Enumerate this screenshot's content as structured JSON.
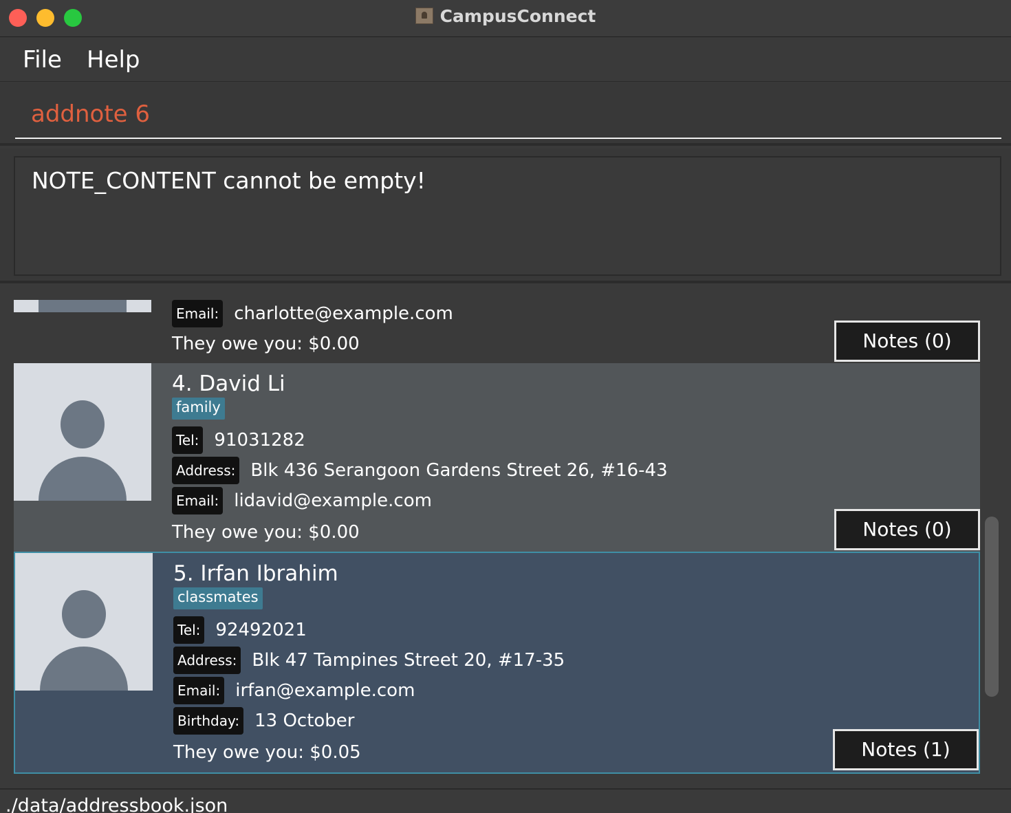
{
  "window": {
    "title": "CampusConnect",
    "icon": "contacts-app-icon"
  },
  "menu": {
    "items": [
      "File",
      "Help"
    ]
  },
  "command": {
    "value": "addnote 6",
    "color": "#e0603f"
  },
  "result": {
    "message": "NOTE_CONTENT cannot be empty!"
  },
  "persons": [
    {
      "email_label": "Email:",
      "email": "charlotte@example.com",
      "owe": "They owe you: $0.00",
      "notes": "Notes (0)"
    },
    {
      "index_name": "4.  David Li",
      "tag": "family",
      "tel_label": "Tel:",
      "tel": "91031282",
      "address_label": "Address:",
      "address": "Blk 436 Serangoon Gardens Street 26, #16-43",
      "email_label": "Email:",
      "email": "lidavid@example.com",
      "owe": "They owe you: $0.00",
      "notes": "Notes (0)"
    },
    {
      "index_name": "5.  Irfan Ibrahim",
      "tag": "classmates",
      "tel_label": "Tel:",
      "tel": "92492021",
      "address_label": "Address:",
      "address": "Blk 47 Tampines Street 20, #17-35",
      "email_label": "Email:",
      "email": "irfan@example.com",
      "birthday_label": "Birthday:",
      "birthday": "13 October",
      "owe": "They owe you: $0.05",
      "notes": "Notes (1)"
    }
  ],
  "status": {
    "file_path": "./data/addressbook.json"
  },
  "colors": {
    "tag_bg": "#3e7b91",
    "selected_card": "#415063",
    "selected_border": "#3f8fa6"
  }
}
